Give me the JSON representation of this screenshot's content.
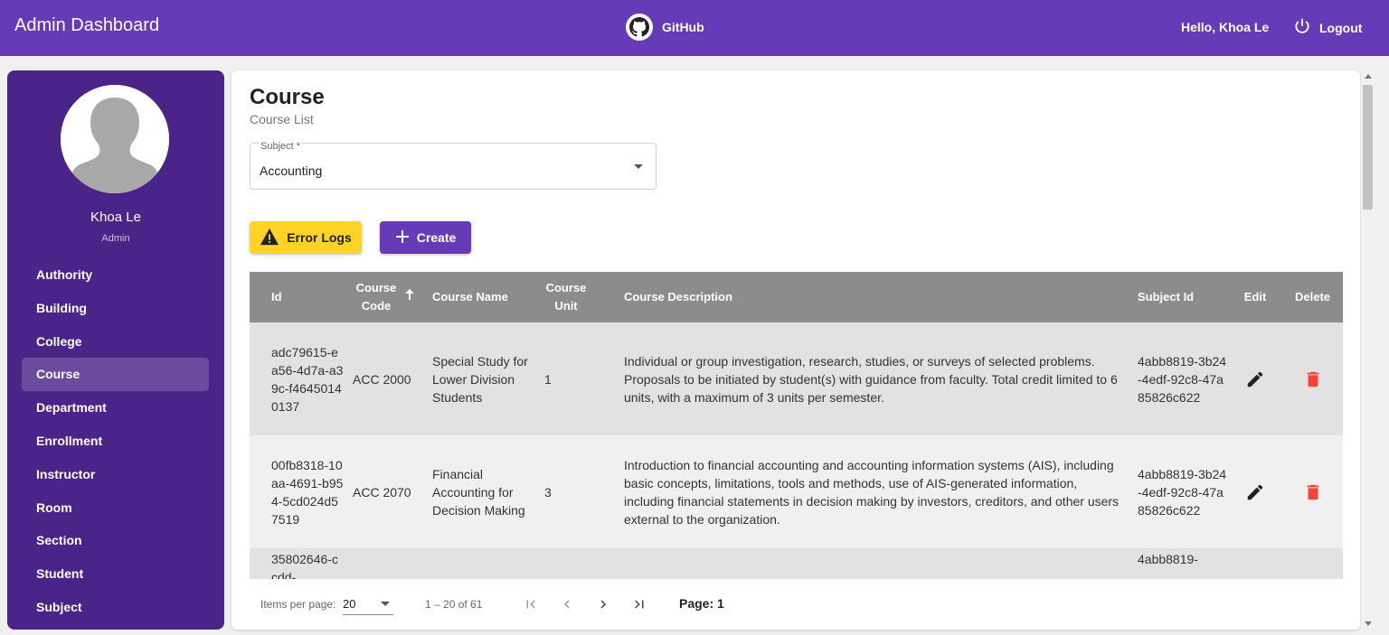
{
  "header": {
    "title": "Admin Dashboard",
    "github_label": "GitHub",
    "greeting": "Hello, Khoa Le",
    "logout_label": "Logout"
  },
  "sidebar": {
    "user_name": "Khoa Le",
    "user_role": "Admin",
    "items": [
      {
        "label": "Authority"
      },
      {
        "label": "Building"
      },
      {
        "label": "College"
      },
      {
        "label": "Course",
        "active": true
      },
      {
        "label": "Department"
      },
      {
        "label": "Enrollment"
      },
      {
        "label": "Instructor"
      },
      {
        "label": "Room"
      },
      {
        "label": "Section"
      },
      {
        "label": "Student"
      },
      {
        "label": "Subject"
      }
    ]
  },
  "main": {
    "title": "Course",
    "subtitle": "Course List",
    "subject_select": {
      "label": "Subject *",
      "value": "Accounting"
    },
    "error_logs_label": "Error Logs",
    "create_label": "Create"
  },
  "table": {
    "columns": {
      "id": "Id",
      "code": "Course Code",
      "name": "Course Name",
      "unit": "Course Unit",
      "description": "Course Description",
      "subject_id": "Subject Id",
      "edit": "Edit",
      "delete": "Delete"
    },
    "rows": [
      {
        "id": "adc79615-ea56-4d7a-a39c-f46450140137",
        "code": "ACC 2000",
        "name": "Special Study for Lower Division Students",
        "unit": "1",
        "description": "Individual or group investigation, research, studies, or surveys of selected problems. Proposals to be initiated by student(s) with guidance from faculty. Total credit limited to 6 units, with a maximum of 3 units per semester.",
        "subject_id": "4abb8819-3b24-4edf-92c8-47a85826c622"
      },
      {
        "id": "00fb8318-10aa-4691-b954-5cd024d57519",
        "code": "ACC 2070",
        "name": "Financial Accounting for Decision Making",
        "unit": "3",
        "description": "Introduction to financial accounting and accounting information systems (AIS), including basic concepts, limitations, tools and methods, use of AIS-generated information, including financial statements in decision making by investors, creditors, and other users external to the organization.",
        "subject_id": "4abb8819-3b24-4edf-92c8-47a85826c622"
      },
      {
        "id": "35802646-ccdd-",
        "code": "",
        "name": "",
        "unit": "",
        "description": "",
        "subject_id": "4abb8819-"
      }
    ]
  },
  "paginator": {
    "items_per_page_label": "Items per page:",
    "items_per_page": "20",
    "range": "1 – 20 of 61",
    "page_label": "Page: 1"
  },
  "colors": {
    "primary": "#673ab7",
    "sidebar": "#4a2489",
    "warn": "#ffd325",
    "delete": "#f44336"
  }
}
